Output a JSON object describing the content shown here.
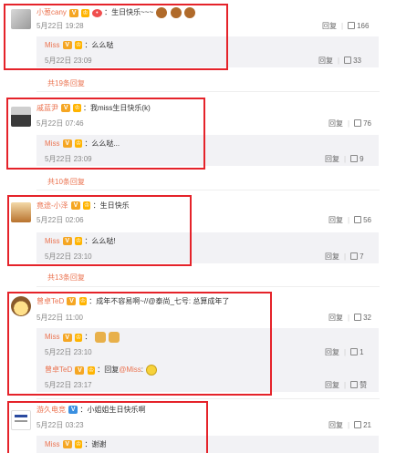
{
  "labels": {
    "reply": "回复",
    "like": "赞"
  },
  "threads": [
    {
      "user": "小葱cany",
      "text": "：生日快乐~~~",
      "date": "5月22日 19:28",
      "likes": "166",
      "reply": {
        "user": "Miss",
        "text": "：么么哒",
        "date": "5月22日 23:09",
        "likes": "33"
      }
    },
    {
      "more": "共19条回复",
      "user": "戚蓝尹",
      "text": "：我miss生日快乐(k)",
      "date": "5月22日 07:46",
      "likes": "76",
      "reply": {
        "user": "Miss",
        "text": "：么么哒...",
        "date": "5月22日 23:09",
        "likes": "9"
      }
    },
    {
      "more": "共10条回复",
      "user": "竟途-小泽",
      "text": "：生日快乐",
      "date": "5月22日 02:06",
      "likes": "56",
      "reply": {
        "user": "Miss",
        "text": "：么么哒!",
        "date": "5月22日 23:10",
        "likes": "7"
      }
    },
    {
      "more": "共13条回复",
      "user": "曾卓TeD",
      "text": "：成年不容易啊~//@泰尚_七号: 总算成年了",
      "date": "5月22日 11:00",
      "likes": "32",
      "reply": {
        "user": "Miss",
        "text": "：",
        "date": "5月22日 23:10",
        "likes": "1"
      },
      "reply2": {
        "user": "曾卓TeD",
        "text": "：回复",
        "mention": "@Miss",
        "text2": ":",
        "date": "5月22日 23:17",
        "likes": "赞"
      }
    },
    {
      "user": "游久电竞",
      "text": "：小姐姐生日快乐啊",
      "date": "5月22日 03:23",
      "likes": "21",
      "reply": {
        "user": "Miss",
        "text": "：谢谢"
      }
    }
  ],
  "colors": {
    "accent": "#eb7350",
    "highlight": "#e5232a",
    "reply_bg": "#f2f2f5"
  }
}
